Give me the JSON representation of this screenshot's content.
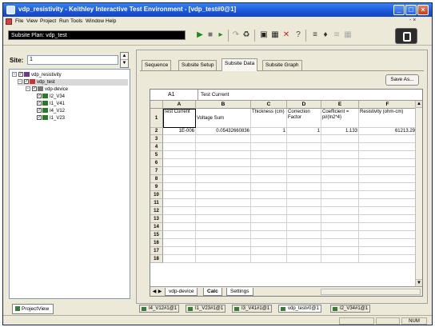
{
  "window": {
    "title": "vdp_resistivity - Keithley Interactive Test Environment - [vdp_test#0@1]"
  },
  "menu": {
    "items": [
      "File",
      "View",
      "Project",
      "Run",
      "Tools",
      "Window",
      "Help"
    ],
    "right_controls": "- ×"
  },
  "toolbar": {
    "subsite_plan": "Subsite Plan: vdp_test"
  },
  "site": {
    "label": "Site:",
    "value": "1"
  },
  "tree": [
    {
      "label": "vdp_resistivity",
      "depth": 0,
      "expander": "−",
      "selected": false
    },
    {
      "label": "vdp_test",
      "depth": 1,
      "expander": "−",
      "selected": true
    },
    {
      "label": "vdp-device",
      "depth": 2,
      "expander": "−",
      "selected": false
    },
    {
      "label": "I2_V34",
      "depth": 3,
      "expander": "",
      "selected": false
    },
    {
      "label": "I1_V41",
      "depth": 3,
      "expander": "",
      "selected": false
    },
    {
      "label": "I4_V12",
      "depth": 3,
      "expander": "",
      "selected": false
    },
    {
      "label": "I1_V23",
      "depth": 3,
      "expander": "",
      "selected": false
    }
  ],
  "project_view_tab": "ProjectView",
  "tabs": [
    {
      "label": "Sequence",
      "active": false
    },
    {
      "label": "Subsite Setup",
      "active": false
    },
    {
      "label": "Subsite Data",
      "active": true
    },
    {
      "label": "Subsite Graph",
      "active": false
    }
  ],
  "save_as_label": "Save As...",
  "sheet": {
    "cell_ref": "A1",
    "formula": "Test Current",
    "columns": [
      "A",
      "B",
      "C",
      "D",
      "E",
      "F"
    ],
    "headers": [
      "Test Current",
      "Voltage Sum",
      "Thickness (cm)",
      "Correction Factor",
      "Coefficient = pi/(ln2*4)",
      "Resistivity (ohm-cm)"
    ],
    "row2": [
      "1E-006",
      "0.05432660836",
      "1",
      "1",
      "1.133",
      "61213.29"
    ],
    "row_numbers": [
      "1",
      "2",
      "3",
      "4",
      "5",
      "6",
      "7",
      "8",
      "9",
      "10",
      "11",
      "12",
      "13",
      "14",
      "15",
      "16",
      "17",
      "18"
    ],
    "sheet_tabs": [
      {
        "label": "vdp-device",
        "active": false
      },
      {
        "label": "Calc",
        "active": true
      },
      {
        "label": "Settings",
        "active": false
      }
    ]
  },
  "doc_tabs": [
    {
      "label": "I4_V12#1@1",
      "active": false
    },
    {
      "label": "I1_V23#1@1",
      "active": false
    },
    {
      "label": "I3_V41#1@1",
      "active": false
    },
    {
      "label": "vdp_test#0@1",
      "active": true
    },
    {
      "label": "I2_V34#1@1",
      "active": false
    }
  ],
  "status": {
    "num": "NUM"
  }
}
